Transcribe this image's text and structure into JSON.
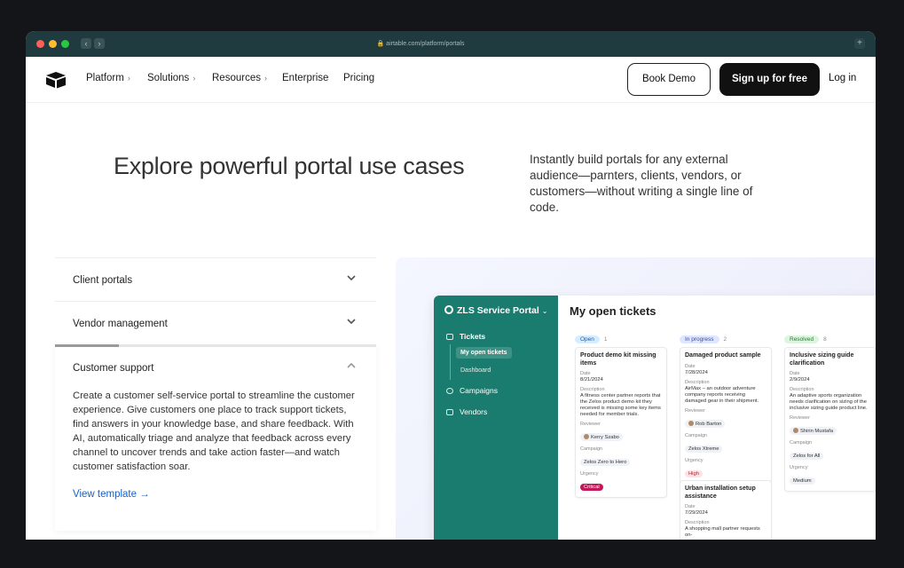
{
  "browser": {
    "url": "airtable.com/platform/portals",
    "back": "‹",
    "forward": "›",
    "new_tab": "+"
  },
  "nav": {
    "items": [
      {
        "label": "Platform",
        "chevron": "›"
      },
      {
        "label": "Solutions",
        "chevron": "›"
      },
      {
        "label": "Resources",
        "chevron": "›"
      },
      {
        "label": "Enterprise"
      },
      {
        "label": "Pricing"
      }
    ],
    "book_demo": "Book Demo",
    "sign_up": "Sign up for free",
    "log_in": "Log in"
  },
  "hero": {
    "title": "Explore powerful portal use cases",
    "description": "Instantly build portals for any external audience—parnters, clients, vendors, or customers—without writing a single line of code."
  },
  "accordion": {
    "items": [
      {
        "label": "Client portals"
      },
      {
        "label": "Vendor management"
      },
      {
        "label": "Customer support",
        "body": "Create a customer self-service portal to streamline the customer experience. Give customers one place to track support tickets, find answers in your knowledge base, and share feedback. With AI, automatically triage and analyze that feedback across every channel to uncover trends and take action faster—and watch customer satisfaction soar.",
        "link": "View template →",
        "progress": 0.2
      }
    ]
  },
  "portal": {
    "title": "ZLS Service Portal",
    "title_chevron": "⌄",
    "nav": [
      "Tickets",
      "My open tickets",
      "Dashboard",
      "Campaigns",
      "Vendors"
    ],
    "page_title": "My open tickets",
    "columns": [
      {
        "status": "Open",
        "count": "1",
        "color": "#d6ecff",
        "text": "#1c5ea8",
        "cards": [
          {
            "title": "Product demo kit missing items",
            "date_label": "Date",
            "date": "8/21/2024",
            "desc_label": "Description",
            "desc": "A fitness center partner reports that the Zelos product demo kit they received is missing some key items needed for member trials.",
            "reviewer_label": "Reviewer",
            "reviewer": "Kerry Szabo",
            "campaign_label": "Campaign",
            "campaign": "Zelos Zero to Hero",
            "urgency_label": "Urgency",
            "urgency": "Critical",
            "urgency_bg": "#c2185b",
            "urgency_fg": "#ffffff"
          }
        ]
      },
      {
        "status": "In progress",
        "count": "2",
        "color": "#dfe6ff",
        "text": "#3a4fa0",
        "cards": [
          {
            "title": "Damaged product sample",
            "date_label": "Date",
            "date": "7/28/2024",
            "desc_label": "Description",
            "desc": "AirMax – an outdoor adventure company reports receiving damaged gear in their shipment.",
            "reviewer_label": "Reviewer",
            "reviewer": "Rob Barton",
            "campaign_label": "Campaign",
            "campaign": "Zelos Xtreme",
            "urgency_label": "Urgency",
            "urgency": "High",
            "urgency_bg": "#fde2e4",
            "urgency_fg": "#b3263a"
          },
          {
            "title": "Urban installation setup assistance",
            "date_label": "Date",
            "date": "7/29/2024",
            "desc_label": "Description",
            "desc": "A shopping mall partner requests on-"
          }
        ]
      },
      {
        "status": "Resolved",
        "count": "8",
        "color": "#dcf5df",
        "text": "#2a7a37",
        "cards": [
          {
            "title": "Inclusive sizing guide clarification",
            "date_label": "Date",
            "date": "2/9/2024",
            "desc_label": "Description",
            "desc": "An adaptive sports organization needs clarification on sizing of the inclusive sizing guide product line.",
            "reviewer_label": "Reviewer",
            "reviewer": "Shirin Mustafa",
            "campaign_label": "Campaign",
            "campaign": "Zelos for All",
            "urgency_label": "Urgency",
            "urgency": "Medium",
            "urgency_bg": "#eef1f5",
            "urgency_fg": "#333333"
          }
        ]
      }
    ]
  }
}
